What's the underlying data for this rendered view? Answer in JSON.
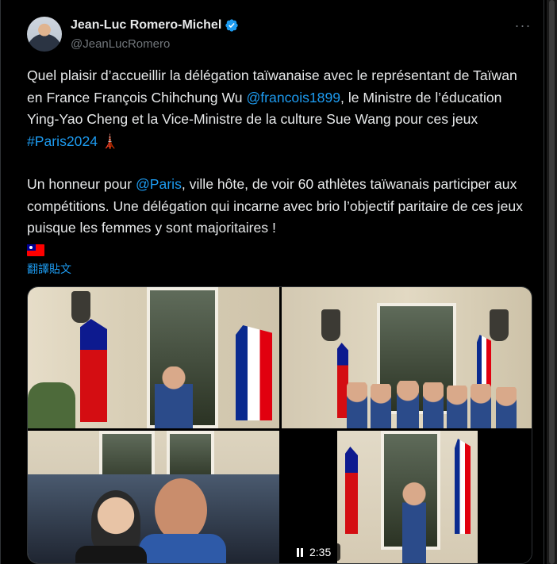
{
  "author": {
    "display_name": "Jean-Luc Romero-Michel",
    "handle": "@JeanLucRomero",
    "verified": true,
    "avatar_icon": "profile-photo"
  },
  "more_label": "···",
  "tweet": {
    "p1_a": "Quel plaisir d’accueillir la délégation taïwanaise avec le représentant de Taïwan en France François Chihchung Wu ",
    "mention1": "@francois1899",
    "p1_b": ", le Ministre de l’éducation Ying-Yao Cheng et la Vice-Ministre de la culture Sue Wang pour ces jeux ",
    "hashtag": "#Paris2024",
    "eiffel": "🗼",
    "p2_a": "Un honneur pour ",
    "mention2": "@Paris",
    "p2_b": ", ville hôte, de voir 60 athlètes taïwanais participer aux compétitions. Une délégation qui incarne avec brio l’objectif paritaire de ces jeux puisque les femmes y sont majoritaires !",
    "flag_icon": "taiwan-flag-icon"
  },
  "translate_label": "翻譯貼文",
  "media": {
    "count": 4,
    "video_duration": "2:35",
    "video_state_icon": "pause-icon"
  },
  "colors": {
    "background": "#000000",
    "text": "#e7e9ea",
    "secondary": "#71767b",
    "link": "#1d9bf0",
    "verified": "#1d9bf0"
  }
}
